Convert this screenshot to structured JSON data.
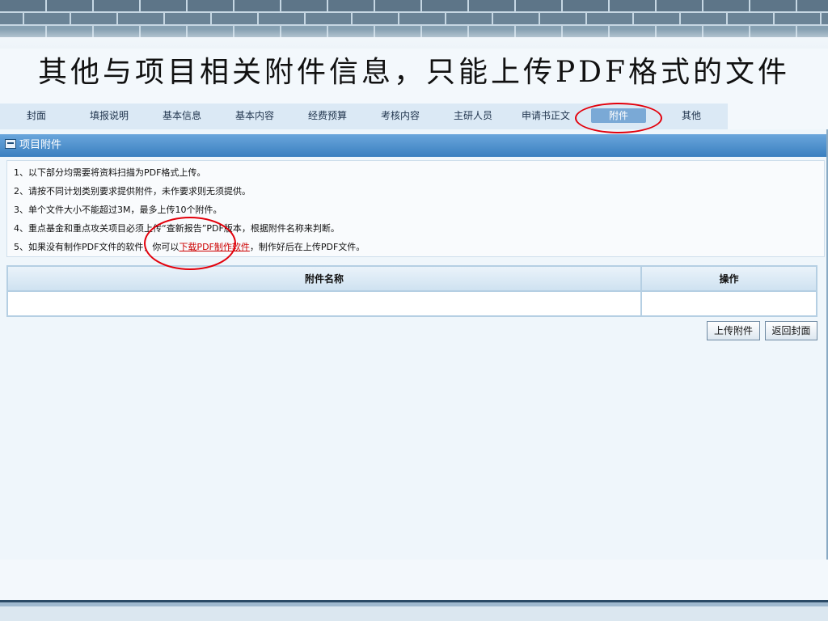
{
  "slide_title": "其他与项目相关附件信息，只能上传PDF格式的文件",
  "nav": {
    "tabs": [
      {
        "label": "封面"
      },
      {
        "label": "填报说明"
      },
      {
        "label": "基本信息"
      },
      {
        "label": "基本内容"
      },
      {
        "label": "经费预算"
      },
      {
        "label": "考核内容"
      },
      {
        "label": "主研人员"
      },
      {
        "label": "申请书正文"
      },
      {
        "label": "附件",
        "active": true
      },
      {
        "label": "其他"
      }
    ]
  },
  "panel": {
    "header": "项目附件",
    "notes": [
      "1、以下部分均需要将资料扫描为PDF格式上传。",
      "2、请按不同计划类别要求提供附件，未作要求则无须提供。",
      "3、单个文件大小不能超过3M，最多上传10个附件。",
      "4、重点基金和重点攻关项目必须上传“查新报告”PDF版本，根据附件名称来判断。"
    ],
    "note5_prefix": "5、如果没有制作PDF文件的软件，你可以",
    "note5_link": "下载PDF制作软件",
    "note5_suffix": "，制作好后在上传PDF文件。"
  },
  "table": {
    "columns": [
      "附件名称",
      "操作"
    ],
    "rows": []
  },
  "buttons": {
    "upload": "上传附件",
    "back": "返回封面"
  },
  "colors": {
    "header_blue": "#3a7fc0",
    "annotation_red": "#e3000b",
    "link_red": "#cc0000"
  }
}
